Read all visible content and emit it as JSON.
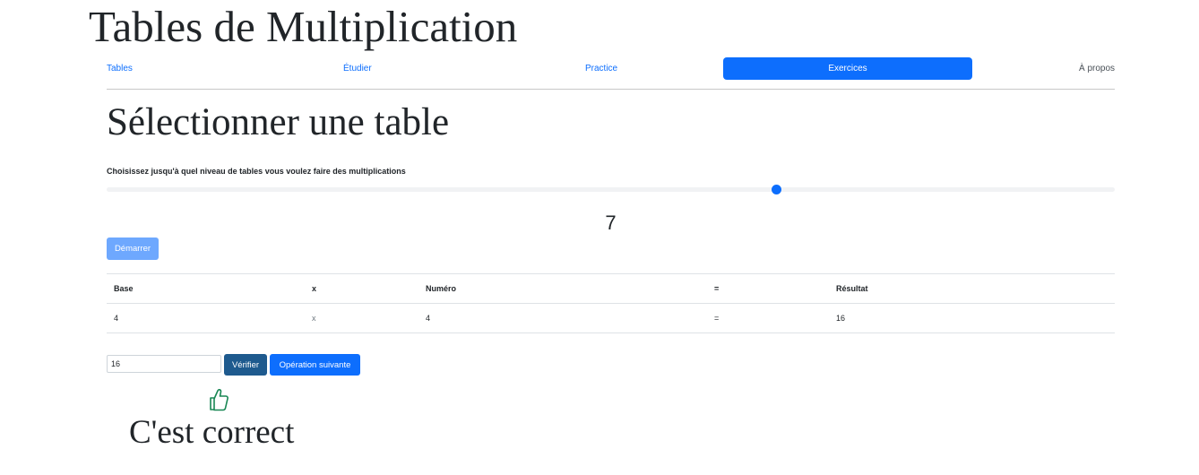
{
  "header": {
    "title": "Tables de Multiplication"
  },
  "nav": {
    "items": [
      {
        "label": "Tables"
      },
      {
        "label": "Étudier"
      },
      {
        "label": "Practice"
      },
      {
        "label": "Exercices"
      },
      {
        "label": "À propos"
      }
    ],
    "active_index": 3
  },
  "main": {
    "section_title": "Sélectionner une table",
    "range_label": "Choisissez jusqu'à quel niveau de tables vous voulez faire des multiplications",
    "range_value": "7",
    "range_fraction": 0.664,
    "start_button": "Démarrer",
    "table": {
      "headers": [
        "Base",
        "x",
        "Numéro",
        "=",
        "Résultat"
      ],
      "rows": [
        [
          "4",
          "x",
          "4",
          "=",
          "16"
        ]
      ]
    },
    "answer_value": "16",
    "verify_button": "Vérifier",
    "next_button": "Opération suivante",
    "feedback": "C'est correct",
    "feedback_icon": "thumbs-up-icon"
  },
  "colors": {
    "primary": "#0d6efd",
    "start_button": "#6ea8fe",
    "verify_button": "#1e5a8e",
    "success_icon": "#198754"
  }
}
